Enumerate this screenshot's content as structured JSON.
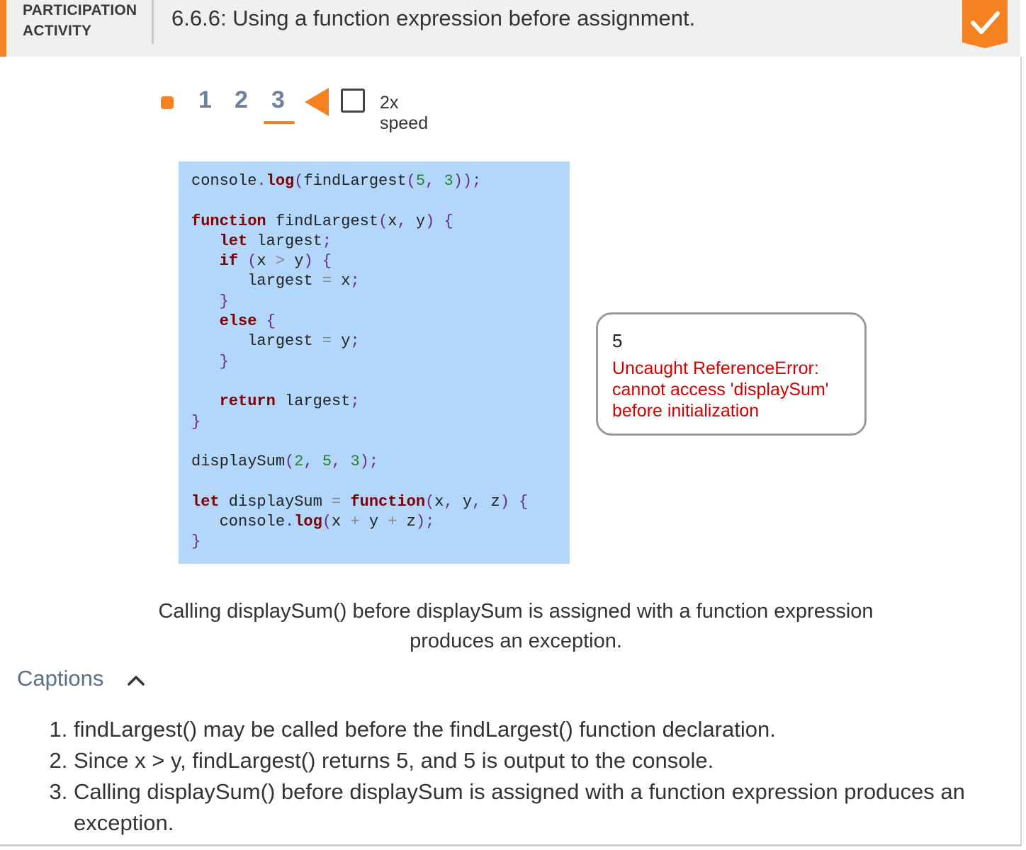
{
  "header": {
    "activity_type": "PARTICIPATION ACTIVITY",
    "title": "6.6.6: Using a function expression before assignment.",
    "accent_color": "#f58220",
    "completion_icon": "checkmark-icon"
  },
  "controls": {
    "play_icon": "stop-square-icon",
    "steps": [
      "1",
      "2",
      "3"
    ],
    "active_step": "3",
    "back_icon": "back-triangle-icon",
    "speed_label": "2x speed",
    "speed_checked": false
  },
  "code": {
    "lines": [
      "console.log(findLargest(5, 3));",
      "",
      "function findLargest(x, y) {",
      "   let largest;",
      "   if (x > y) {",
      "      largest = x;",
      "   }",
      "   else {",
      "      largest = y;",
      "   }",
      "",
      "   return largest;",
      "}",
      "",
      "displaySum(2, 5, 3);",
      "",
      "let displaySum = function(x, y, z) {",
      "   console.log(x + y + z);",
      "}"
    ]
  },
  "console": {
    "output": "5",
    "error": "Uncaught ReferenceError: cannot access 'displaySum' before initialization",
    "error_color": "#d40000"
  },
  "step_caption": "Calling displaySum() before displaySum is assigned with a function expression produces an exception.",
  "captions": {
    "label": "Captions",
    "toggle_icon": "chevron-up-icon",
    "items": [
      "findLargest() may be called before the findLargest() function declaration.",
      "Since x > y, findLargest() returns 5, and 5 is output to the console.",
      "Calling displaySum() before displaySum is assigned with a function expression produces an exception."
    ]
  }
}
